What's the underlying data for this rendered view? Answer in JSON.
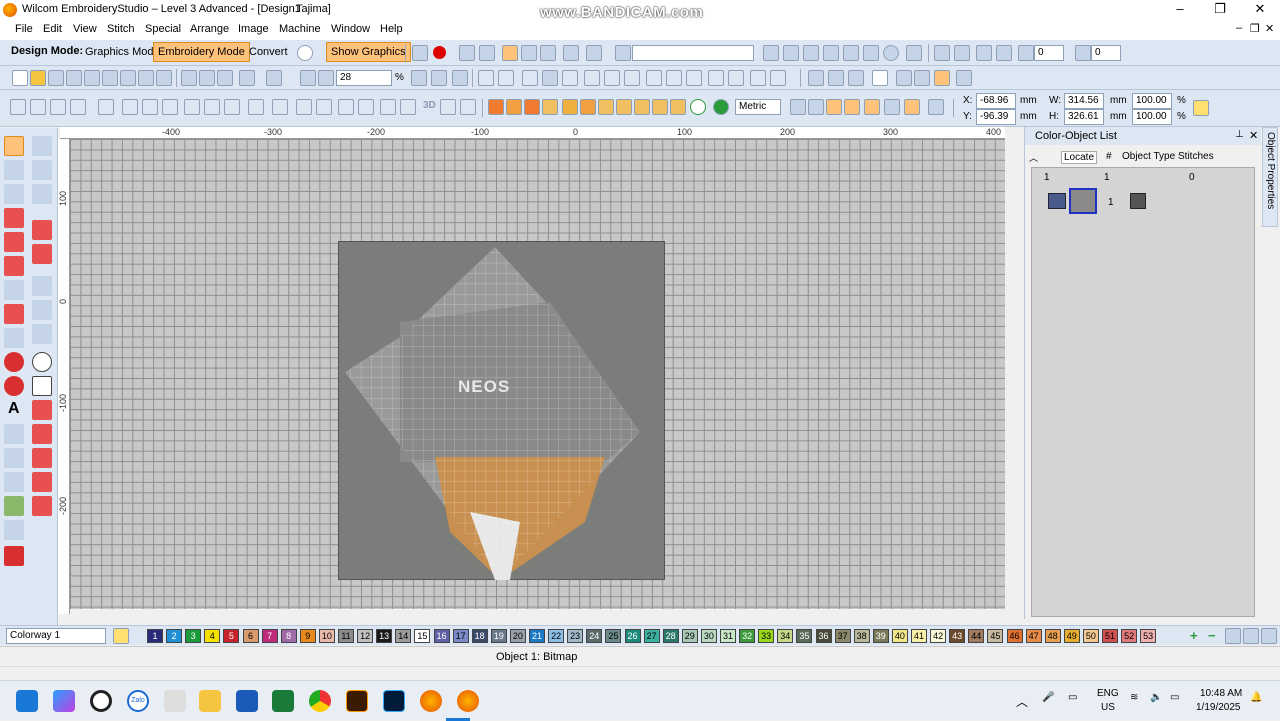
{
  "window": {
    "title": "Wilcom EmbroideryStudio – Level 3 Advanced - [Design1",
    "title_suffix": "Tajima]",
    "watermark": "www.BANDICAM.com",
    "minimize": "–",
    "restore": "❐",
    "close": "✕"
  },
  "menu": [
    "File",
    "Edit",
    "View",
    "Stitch",
    "Special",
    "Arrange",
    "Image",
    "Machine",
    "Window",
    "Help"
  ],
  "mdi_controls": [
    "–",
    "❐",
    "✕"
  ],
  "modebar": {
    "label": "Design Mode:",
    "graphics": "Graphics Mode",
    "embroidery": "Embroidery Mode",
    "convert": "Convert",
    "show_graphics": "Show Graphics",
    "rotate_value": "0",
    "slant_value": "0"
  },
  "toolbar2": {
    "zoom_value": "28",
    "zoom_unit": "%"
  },
  "toolbar3": {
    "units": "Metric",
    "x_label": "X:",
    "x_value": "-68.96",
    "x_unit": "mm",
    "y_label": "Y:",
    "y_value": "-96.39",
    "y_unit": "mm",
    "w_label": "W:",
    "w_value": "314.56",
    "w_unit": "mm",
    "w_pct": "100.00",
    "w_pct_unit": "%",
    "h_label": "H:",
    "h_value": "326.61",
    "h_unit": "mm",
    "h_pct": "100.00",
    "h_pct_unit": "%"
  },
  "ruler": {
    "top": [
      "-400",
      "-300",
      "-200",
      "-100",
      "0",
      "100",
      "200",
      "300",
      "400"
    ],
    "left": [
      "100",
      "0",
      "-100",
      "-200"
    ]
  },
  "canvas": {
    "image_text": "NEOS"
  },
  "panel": {
    "title": "Color-Object List",
    "locate": "Locate",
    "col_hash": "#",
    "col_type": "Object Type",
    "col_stitches": "Stitches",
    "row1_num": "1",
    "row1_hash": "1",
    "row1_stitches": "0",
    "row2_hash": "1",
    "side_tab": "Object Properties"
  },
  "colorbar": {
    "colorway": "Colorway 1",
    "swatches": [
      {
        "n": "1",
        "c": "#2a2a7a",
        "fg": "#fff"
      },
      {
        "n": "2",
        "c": "#1f8fd6",
        "fg": "#fff"
      },
      {
        "n": "3",
        "c": "#1a9a3a",
        "fg": "#fff"
      },
      {
        "n": "4",
        "c": "#f3e200",
        "fg": "#000"
      },
      {
        "n": "5",
        "c": "#c8232c",
        "fg": "#fff"
      },
      {
        "n": "6",
        "c": "#d99a6c",
        "fg": "#000"
      },
      {
        "n": "7",
        "c": "#c02a7a",
        "fg": "#fff"
      },
      {
        "n": "8",
        "c": "#a06aa8",
        "fg": "#fff"
      },
      {
        "n": "9",
        "c": "#e88a1a",
        "fg": "#000"
      },
      {
        "n": "10",
        "c": "#e8b8a8",
        "fg": "#000"
      },
      {
        "n": "11",
        "c": "#8a8a8a",
        "fg": "#000"
      },
      {
        "n": "12",
        "c": "#c0c0c0",
        "fg": "#000"
      },
      {
        "n": "13",
        "c": "#1a1a1a",
        "fg": "#fff"
      },
      {
        "n": "14",
        "c": "#9a9a9a",
        "fg": "#000"
      },
      {
        "n": "15",
        "c": "#ffffff",
        "fg": "#000"
      },
      {
        "n": "16",
        "c": "#6060a8",
        "fg": "#fff"
      },
      {
        "n": "17",
        "c": "#7a8ac8",
        "fg": "#000"
      },
      {
        "n": "18",
        "c": "#3a4a6a",
        "fg": "#fff"
      },
      {
        "n": "19",
        "c": "#6a7a8a",
        "fg": "#fff"
      },
      {
        "n": "20",
        "c": "#9aa0a8",
        "fg": "#000"
      },
      {
        "n": "21",
        "c": "#1a7ac8",
        "fg": "#fff"
      },
      {
        "n": "22",
        "c": "#8ac0e8",
        "fg": "#000"
      },
      {
        "n": "23",
        "c": "#a0b8c8",
        "fg": "#000"
      },
      {
        "n": "24",
        "c": "#5a6a6a",
        "fg": "#fff"
      },
      {
        "n": "25",
        "c": "#6a8a8a",
        "fg": "#000"
      },
      {
        "n": "26",
        "c": "#1a8a7a",
        "fg": "#fff"
      },
      {
        "n": "27",
        "c": "#3ab0a0",
        "fg": "#000"
      },
      {
        "n": "28",
        "c": "#2a7a6a",
        "fg": "#fff"
      },
      {
        "n": "29",
        "c": "#a8c8b8",
        "fg": "#000"
      },
      {
        "n": "30",
        "c": "#b8d8c0",
        "fg": "#000"
      },
      {
        "n": "31",
        "c": "#c8e8c8",
        "fg": "#000"
      },
      {
        "n": "32",
        "c": "#3a9a3a",
        "fg": "#fff"
      },
      {
        "n": "33",
        "c": "#9ad81a",
        "fg": "#000"
      },
      {
        "n": "34",
        "c": "#c8d88a",
        "fg": "#000"
      },
      {
        "n": "35",
        "c": "#5a6a5a",
        "fg": "#fff"
      },
      {
        "n": "36",
        "c": "#4a4a3a",
        "fg": "#fff"
      },
      {
        "n": "37",
        "c": "#8a8a6a",
        "fg": "#000"
      },
      {
        "n": "38",
        "c": "#b8b89a",
        "fg": "#000"
      },
      {
        "n": "39",
        "c": "#7a7a5a",
        "fg": "#fff"
      },
      {
        "n": "40",
        "c": "#f0e68a",
        "fg": "#000"
      },
      {
        "n": "41",
        "c": "#f8f0a8",
        "fg": "#000"
      },
      {
        "n": "42",
        "c": "#f8f8d8",
        "fg": "#000"
      },
      {
        "n": "43",
        "c": "#6a4a2a",
        "fg": "#fff"
      },
      {
        "n": "44",
        "c": "#a07a5a",
        "fg": "#000"
      },
      {
        "n": "45",
        "c": "#c8b8a0",
        "fg": "#000"
      },
      {
        "n": "46",
        "c": "#e07030",
        "fg": "#000"
      },
      {
        "n": "47",
        "c": "#e88a4a",
        "fg": "#000"
      },
      {
        "n": "48",
        "c": "#e8a050",
        "fg": "#000"
      },
      {
        "n": "49",
        "c": "#e8b030",
        "fg": "#000"
      },
      {
        "n": "50",
        "c": "#f0c890",
        "fg": "#000"
      },
      {
        "n": "51",
        "c": "#d05050",
        "fg": "#000"
      },
      {
        "n": "52",
        "c": "#e07a7a",
        "fg": "#000"
      },
      {
        "n": "53",
        "c": "#f0b0b0",
        "fg": "#000"
      }
    ]
  },
  "status": {
    "object": "Object 1: Bitmap"
  },
  "taskbar": {
    "lang": "ENG",
    "region": "US",
    "time": "10:48 AM",
    "date": "1/19/2025",
    "zalo": "Zalo"
  }
}
